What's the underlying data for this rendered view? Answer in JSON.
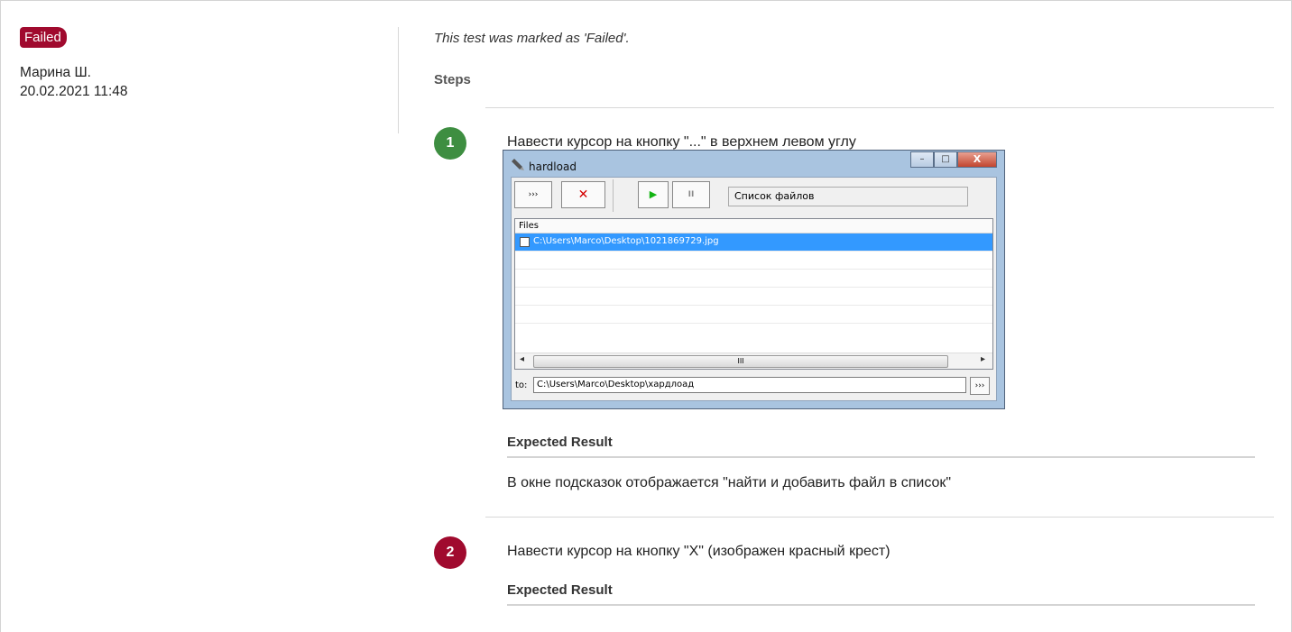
{
  "result": {
    "status": "Failed",
    "author": "Марина Ш.",
    "datetime": "20.02.2021 11:48"
  },
  "note": "This test was marked as 'Failed'.",
  "steps_heading": "Steps",
  "steps": [
    {
      "number": "1",
      "status_color": "#3e8e41",
      "text": "Навести курсор на кнопку \"...\" в верхнем левом углу",
      "expected_heading": "Expected Result",
      "expected_text": "В окне подсказок отображается \"найти и добавить файл в список\""
    },
    {
      "number": "2",
      "status_color": "#a00a2e",
      "text": "Навести курсор на кнопку \"X\" (изображен красный крест)",
      "expected_heading": "Expected Result"
    }
  ],
  "screenshot": {
    "title": "hardload",
    "window_buttons": {
      "minimize": "–",
      "maximize": "□",
      "close": "X"
    },
    "toolbar": {
      "browse": "›››",
      "delete": "✕",
      "play": "▶",
      "pause": "II"
    },
    "status_text": "Список файлов",
    "list_header": "Files",
    "rows": [
      "C:\\Users\\Marco\\Desktop\\1021869729.jpg",
      "",
      "",
      "",
      ""
    ],
    "scroll_thumb": "III",
    "to_label": "to:",
    "to_value": "C:\\Users\\Marco\\Desktop\\хардлоад",
    "to_browse": "›››"
  },
  "colors": {
    "failed": "#a00a2e",
    "passed": "#3e8e41",
    "selection": "#3399ff"
  }
}
